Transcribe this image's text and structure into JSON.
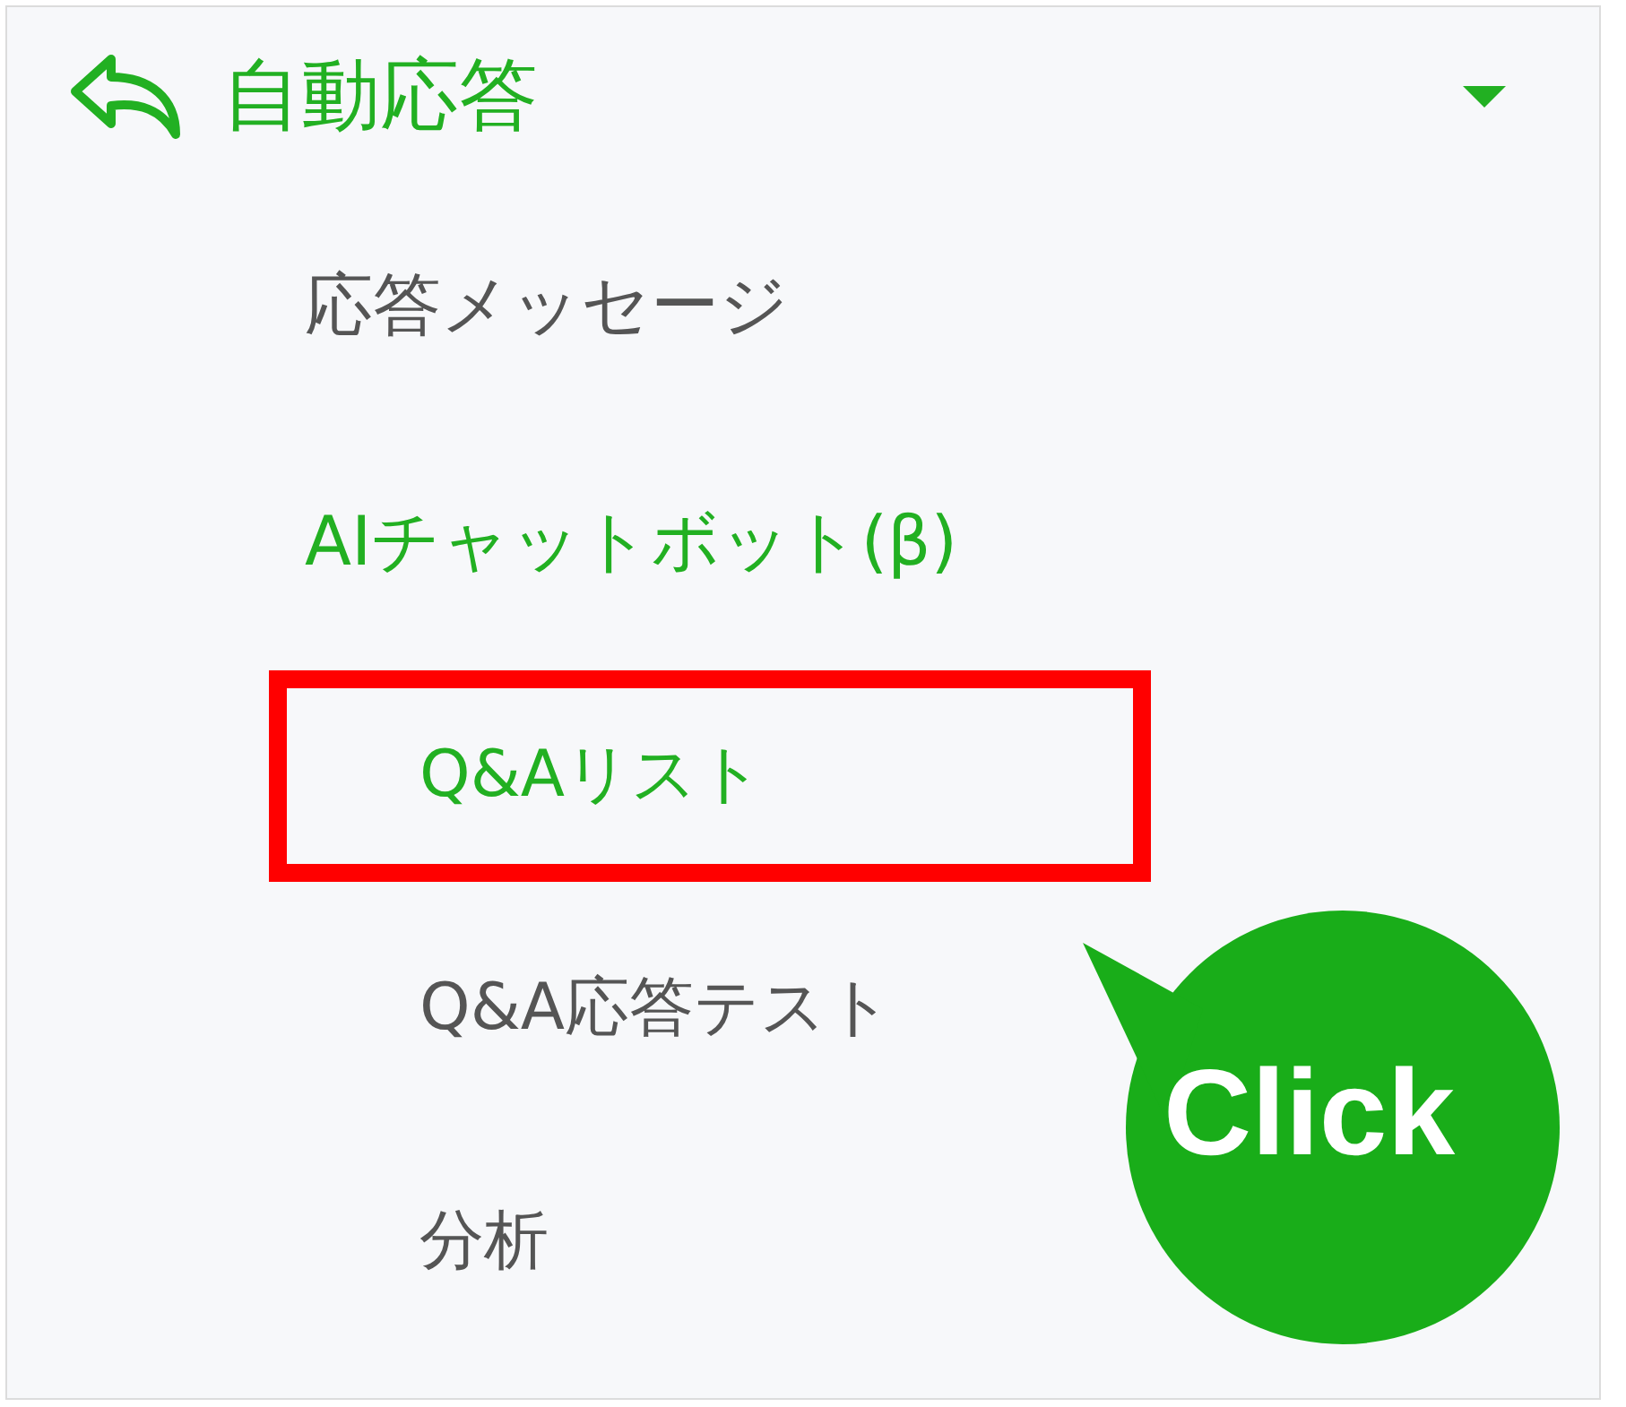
{
  "menu": {
    "title": "自動応答",
    "expanded": true,
    "items": [
      {
        "label": "応答メッセージ",
        "selected": false
      },
      {
        "label": "AIチャットボット(β)",
        "selected": true,
        "children": [
          {
            "label": "Q&Aリスト",
            "selected": true,
            "highlighted": true
          },
          {
            "label": "Q&A応答テスト",
            "selected": false,
            "highlighted": false
          },
          {
            "label": "分析",
            "selected": false,
            "highlighted": false
          }
        ]
      }
    ]
  },
  "callout": {
    "text": "Click"
  }
}
